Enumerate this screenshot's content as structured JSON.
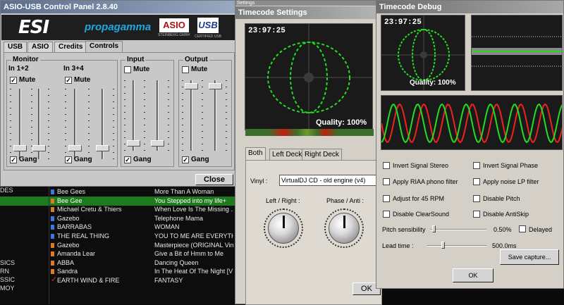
{
  "esi_panel": {
    "title": "ASIO-USB Control Panel 2.8.40",
    "logos": {
      "esi": "ESI",
      "propagamma": "propagamma",
      "asio": "ASIO",
      "asio_sub": "STEINBERG GMBH",
      "usb": "USB",
      "usb_sub": "CERTIFIED USB"
    },
    "tabs": [
      "USB",
      "ASIO",
      "Credits",
      "Controls"
    ],
    "active_tab": "Controls",
    "monitor_label": "Monitor",
    "in12_label": "In 1+2",
    "in34_label": "In 3+4",
    "input_label": "Input",
    "output_label": "Output",
    "mute_label": "Mute",
    "gang_label": "Gang",
    "close_label": "Close",
    "check_mark": "✓"
  },
  "timecode_settings": {
    "hidden_title": "Settings",
    "title": "Timecode Settings",
    "time": "23:97:25",
    "quality": "Quality: 100%",
    "tabs": [
      "Both",
      "Left Deck",
      "Right Deck"
    ],
    "active_tab": "Both",
    "vinyl_label": "Vinyl :",
    "vinyl_value": "VirtualDJ CD - old engine (v4)",
    "left_right_label": "Left / Right :",
    "phase_label": "Phase / Anti :",
    "ok_label": "OK"
  },
  "timecode_debug": {
    "title": "Timecode Debug",
    "time": "23:97:25",
    "quality": "Quality: 100%",
    "options_left": [
      "Invert Signal Stereo",
      "Apply RIAA phono filter",
      "Adjust for 45 RPM",
      "Disable ClearSound"
    ],
    "options_right": [
      "Invert Signal Phase",
      "Apply noise LP filter",
      "Disable Pitch",
      "Disable AntiSkip"
    ],
    "pitch_label": "Pitch sensibility",
    "pitch_value": "0.50%",
    "delayed_label": "Delayed",
    "lead_label": "Lead time :",
    "lead_value": "500.0ms",
    "save_label": "Save capture...",
    "ok_label": "OK"
  },
  "song_list": {
    "side_labels": [
      "DES",
      "SICS",
      "RN",
      "SSIC",
      "MOY"
    ],
    "rows": [
      {
        "artist": "Bee Gees",
        "title": "More Than A Woman",
        "icon": "blue",
        "selected": false
      },
      {
        "artist": "Bee Gee",
        "title": "You Stepped into my life+",
        "icon": "orange",
        "selected": true
      },
      {
        "artist": "Michael Cretu & Thiers",
        "title": "When Love Is The Missing ...",
        "icon": "orange",
        "selected": false
      },
      {
        "artist": "Gazebo",
        "title": "Telephone Mama",
        "icon": "blue",
        "selected": false
      },
      {
        "artist": "BARRABAS",
        "title": "WOMAN",
        "icon": "blue",
        "selected": false
      },
      {
        "artist": "THE REAL THING",
        "title": "YOU TO ME ARE EVERYTHI...",
        "icon": "blue",
        "selected": false
      },
      {
        "artist": "Gazebo",
        "title": "Masterpiece (ORIGINAL Vin...",
        "icon": "orange",
        "selected": false
      },
      {
        "artist": "Amanda Lear",
        "title": "Give a Bit of Hmm to Me",
        "icon": "orange",
        "selected": false
      },
      {
        "artist": "ABBA",
        "title": "Dancing Queen",
        "icon": "orange",
        "selected": false
      },
      {
        "artist": "Sandra",
        "title": "In The Heat Of The Night [VI...",
        "icon": "orange",
        "selected": false
      },
      {
        "artist": "EARTH WIND & FIRE",
        "title": "FANTASY",
        "icon": "red-check",
        "selected": false
      }
    ]
  },
  "colors": {
    "scope_bg": "#1a1a1a",
    "trace_green": "#22dd22",
    "trace_red": "#ee2222",
    "selection_green": "#1f7a1f",
    "icon_blue": "#3a78e0",
    "icon_orange": "#e07a20"
  }
}
